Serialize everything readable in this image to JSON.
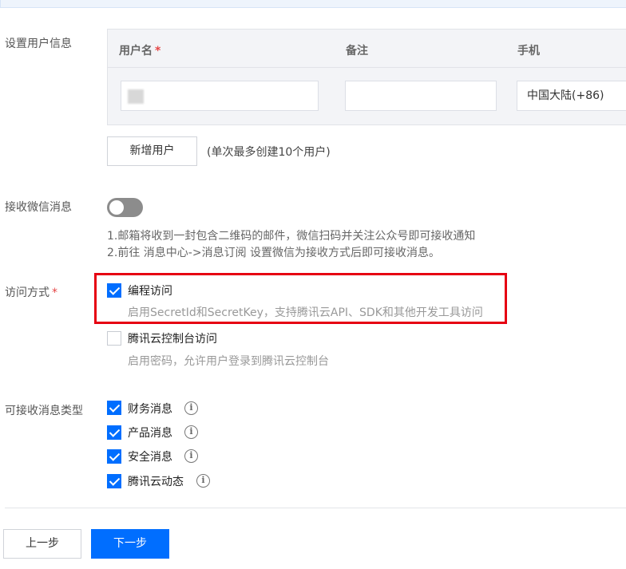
{
  "user_info": {
    "label": "设置用户信息",
    "table_headers": {
      "username": "用户名",
      "required_mark": "*",
      "remark": "备注",
      "phone": "手机"
    },
    "row": {
      "username_value": "",
      "remark_value": "",
      "phone_region": "中国大陆(+86)"
    },
    "add_user_button": "新增用户",
    "add_user_hint": "(单次最多创建10个用户)"
  },
  "wechat": {
    "label": "接收微信消息",
    "toggle_on": false,
    "desc_line1": "1.邮箱将收到一封包含二维码的邮件，微信扫码并关注公众号即可接收通知",
    "desc_line2": "2.前往 消息中心->消息订阅 设置微信为接收方式后即可接收消息。"
  },
  "access": {
    "label": "访问方式",
    "required_mark": "*",
    "options": [
      {
        "label": "编程访问",
        "desc": "启用SecretId和SecretKey，支持腾讯云API、SDK和其他开发工具访问",
        "checked": true
      },
      {
        "label": "腾讯云控制台访问",
        "desc": "启用密码，允许用户登录到腾讯云控制台",
        "checked": false
      }
    ]
  },
  "message_types": {
    "label": "可接收消息类型",
    "options": [
      {
        "label": "财务消息",
        "checked": true
      },
      {
        "label": "产品消息",
        "checked": true
      },
      {
        "label": "安全消息",
        "checked": true
      },
      {
        "label": "腾讯云动态",
        "checked": true
      }
    ],
    "info_glyph": "i"
  },
  "footer": {
    "prev_button": "上一步",
    "next_button": "下一步"
  },
  "colors": {
    "primary": "#006eff",
    "highlight": "#e60012",
    "required": "#e54545"
  }
}
